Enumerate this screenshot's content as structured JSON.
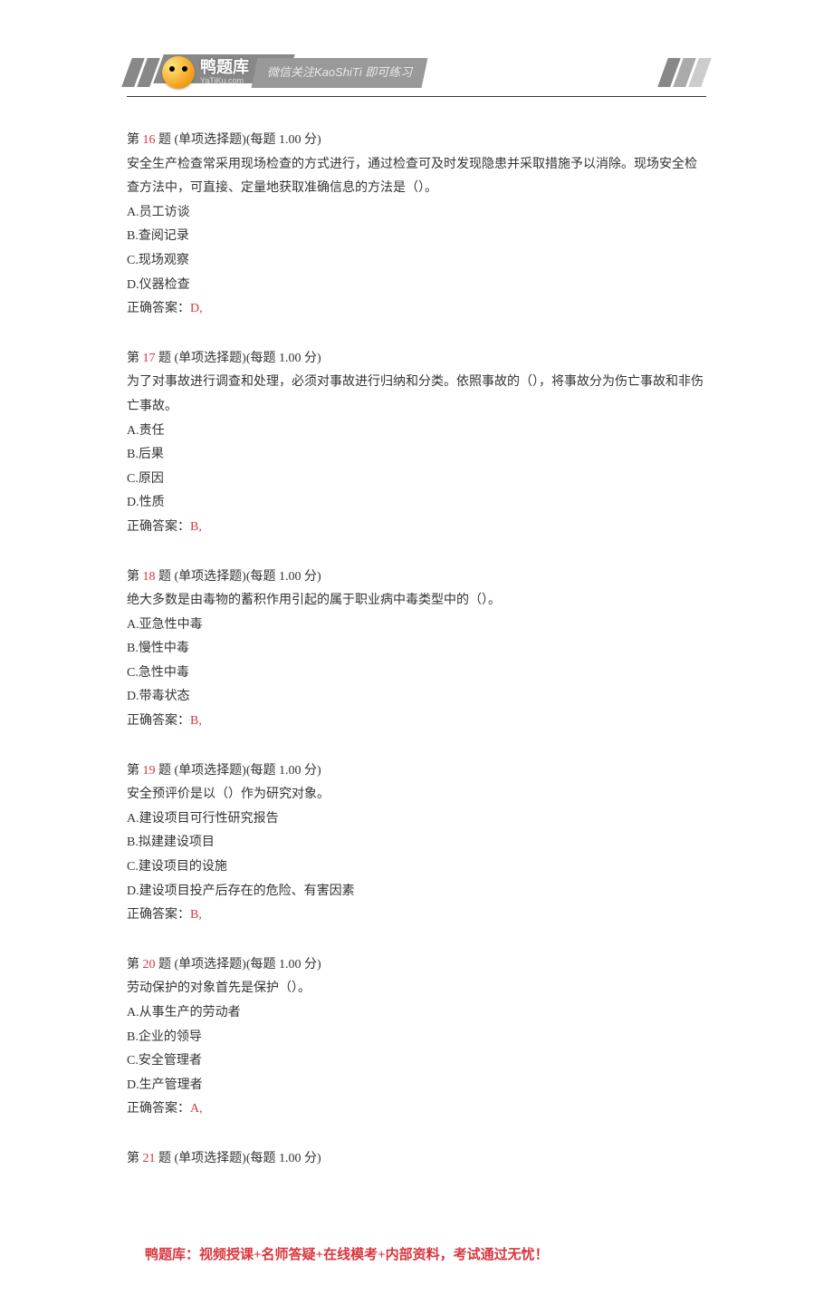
{
  "header": {
    "logo_main": "鸭题库",
    "logo_sub": "YaTiKu.com",
    "slogan": "微信关注KaoShiTi 即可练习"
  },
  "questions": [
    {
      "prefix": "第",
      "number": "16",
      "suffix": "题 (单项选择题)(每题 1.00 分)",
      "stem": "安全生产检查常采用现场检查的方式进行，通过检查可及时发现隐患并采取措施予以消除。现场安全检查方法中，可直接、定量地获取准确信息的方法是（）。",
      "options": [
        "A.员工访谈",
        "B.查阅记录",
        "C.现场观察",
        "D.仪器检查"
      ],
      "answer_label": "正确答案：",
      "answer": "D,"
    },
    {
      "prefix": "第",
      "number": "17",
      "suffix": "题 (单项选择题)(每题 1.00 分)",
      "stem": "为了对事故进行调查和处理，必须对事故进行归纳和分类。依照事故的（），将事故分为伤亡事故和非伤亡事故。",
      "options": [
        "A.责任",
        "B.后果",
        "C.原因",
        "D.性质"
      ],
      "answer_label": "正确答案：",
      "answer": "B,"
    },
    {
      "prefix": "第",
      "number": "18",
      "suffix": "题 (单项选择题)(每题 1.00 分)",
      "stem": "绝大多数是由毒物的蓄积作用引起的属于职业病中毒类型中的（）。",
      "options": [
        "A.亚急性中毒",
        "B.慢性中毒",
        "C.急性中毒",
        "D.带毒状态"
      ],
      "answer_label": "正确答案：",
      "answer": "B,"
    },
    {
      "prefix": "第",
      "number": "19",
      "suffix": "题 (单项选择题)(每题 1.00 分)",
      "stem": "安全预评价是以（）作为研究对象。",
      "options": [
        "A.建设项目可行性研究报告",
        "B.拟建建设项目",
        "C.建设项目的设施",
        "D.建设项目投产后存在的危险、有害因素"
      ],
      "answer_label": "正确答案：",
      "answer": "B,"
    },
    {
      "prefix": "第",
      "number": "20",
      "suffix": "题 (单项选择题)(每题 1.00 分)",
      "stem": "劳动保护的对象首先是保护（）。",
      "options": [
        "A.从事生产的劳动者",
        "B.企业的领导",
        "C.安全管理者",
        "D.生产管理者"
      ],
      "answer_label": "正确答案：",
      "answer": "A,"
    },
    {
      "prefix": "第",
      "number": "21",
      "suffix": "题 (单项选择题)(每题 1.00 分)",
      "stem": "",
      "options": [],
      "answer_label": "",
      "answer": ""
    }
  ],
  "footer": "鸭题库：视频授课+名师答疑+在线模考+内部资料，考试通过无忧！"
}
